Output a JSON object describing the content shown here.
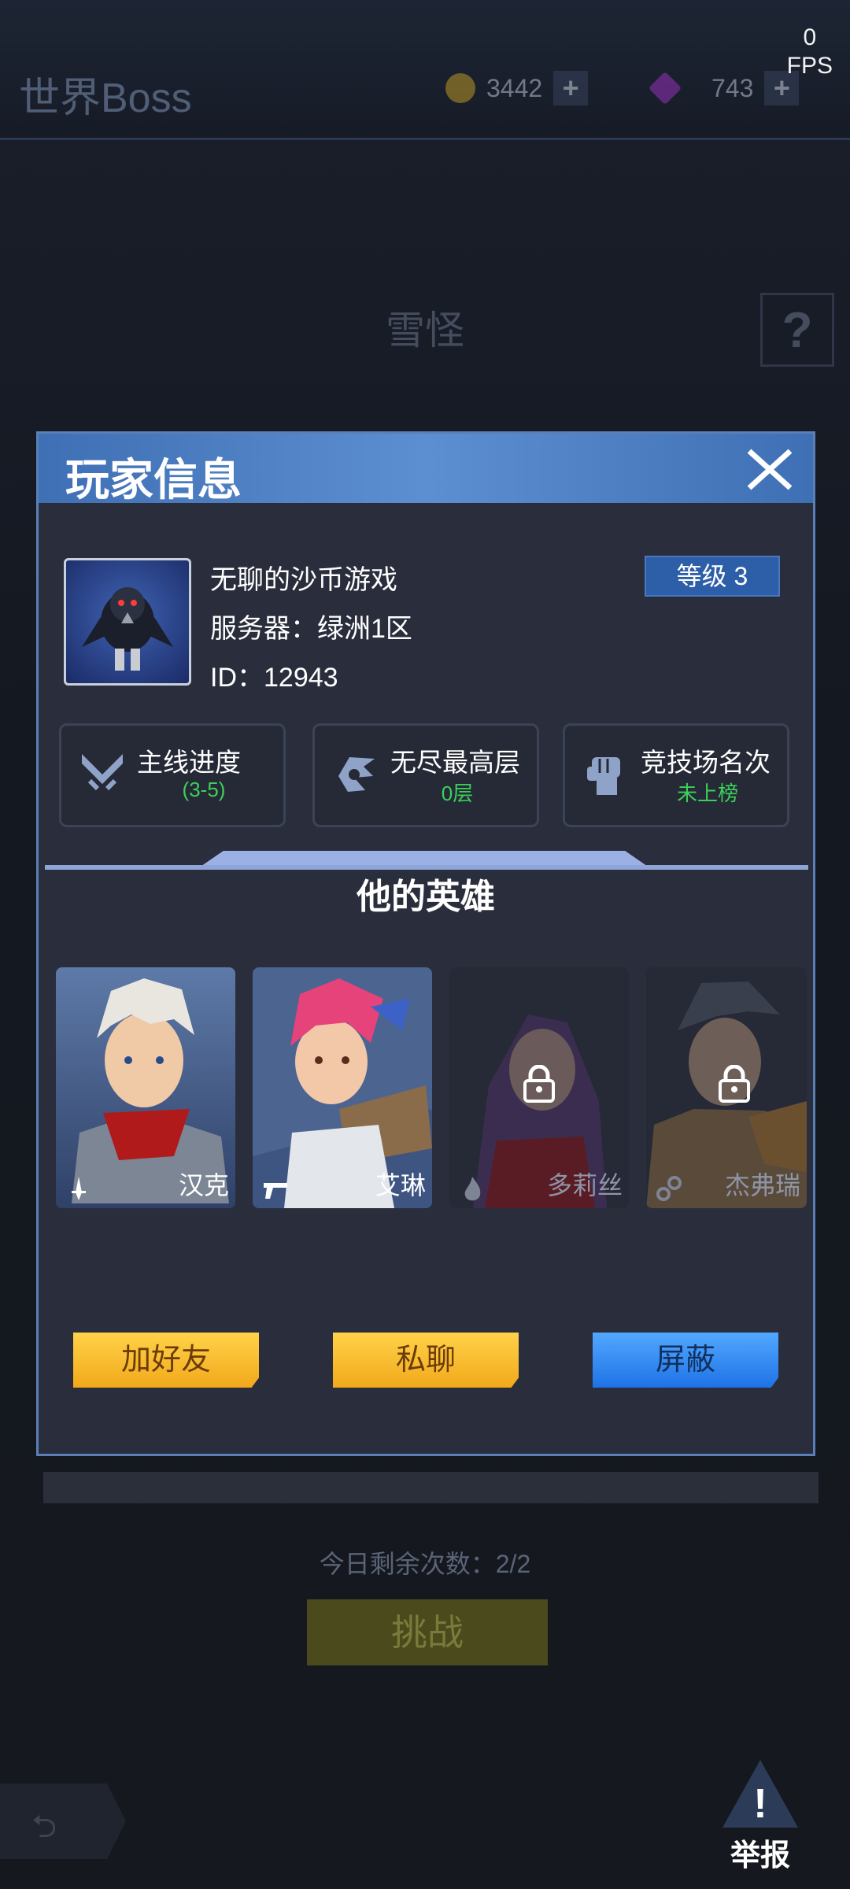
{
  "background": {
    "title": "世界Boss",
    "gold": "3442",
    "gems": "743",
    "fps_value": "0",
    "fps_label": "FPS",
    "boss_name": "雪怪",
    "help": "?",
    "remaining": "今日剩余次数：2/2",
    "challenge": "挑战"
  },
  "report": {
    "label": "举报"
  },
  "modal": {
    "title": "玩家信息",
    "player": {
      "name": "无聊的沙币游戏",
      "server": "服务器：绿洲1区",
      "id": "ID：12943",
      "level": "等级 3"
    },
    "stats": [
      {
        "label": "主线进度",
        "value": "(3-5)",
        "icon": "crossed-swords-icon"
      },
      {
        "label": "无尽最高层",
        "value": "0层",
        "icon": "endless-spiral-icon"
      },
      {
        "label": "竞技场名次",
        "value": "未上榜",
        "icon": "fist-icon"
      }
    ],
    "heroes_title": "他的英雄",
    "heroes": [
      {
        "name": "汉克",
        "locked": false
      },
      {
        "name": "艾琳",
        "locked": false
      },
      {
        "name": "多莉丝",
        "locked": true
      },
      {
        "name": "杰弗瑞",
        "locked": true
      }
    ],
    "buttons": {
      "add_friend": "加好友",
      "private_chat": "私聊",
      "block": "屏蔽"
    }
  },
  "colors": {
    "accent_blue": "#5c8fd1",
    "value_green": "#3bd05a",
    "button_yellow": "#f2a91a",
    "button_blue": "#1f72e6"
  }
}
